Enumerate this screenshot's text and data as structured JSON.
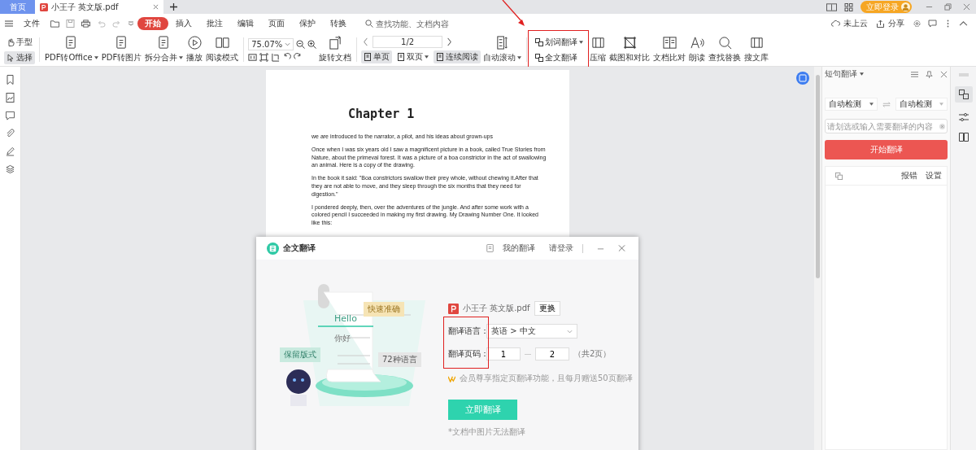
{
  "tabs": [
    {
      "label": "首页",
      "kind": "home",
      "selected": false
    },
    {
      "label": "小王子 英文版.pdf",
      "kind": "doc",
      "selected": true
    }
  ],
  "account": {
    "login": "立即登录"
  },
  "menu": {
    "items": [
      {
        "label": "文件",
        "selected": false
      },
      {
        "label": "开始",
        "selected": true
      },
      {
        "label": "插入",
        "selected": false
      },
      {
        "label": "批注",
        "selected": false
      },
      {
        "label": "编辑",
        "selected": false
      },
      {
        "label": "页面",
        "selected": false
      },
      {
        "label": "保护",
        "selected": false
      },
      {
        "label": "转换",
        "selected": false
      }
    ],
    "search_placeholder": "查找功能、文档内容",
    "cloud": "未上云",
    "share": "分享"
  },
  "toolbar": {
    "pointer_tools": [
      {
        "label": "手型",
        "selected": false
      },
      {
        "label": "选择",
        "selected": true
      }
    ],
    "convert_tools": [
      {
        "label": "PDF转Office",
        "dropdown": true
      },
      {
        "label": "PDF转图片",
        "dropdown": false
      },
      {
        "label": "拆分合并",
        "dropdown": true
      },
      {
        "label": "播放",
        "dropdown": false
      },
      {
        "label": "阅读模式",
        "dropdown": false
      }
    ],
    "zoom": "75.07%",
    "rotate": "旋转文档",
    "page": "1/2",
    "view_modes": [
      {
        "label": "单页",
        "selected": true,
        "dropdown": false
      },
      {
        "label": "双页",
        "selected": false,
        "dropdown": true
      },
      {
        "label": "连续阅读",
        "selected": true,
        "dropdown": false
      }
    ],
    "auto_scroll": "自动滚动",
    "translate": [
      {
        "label": "划词翻译",
        "dropdown": true
      },
      {
        "label": "全文翻译",
        "dropdown": false
      }
    ],
    "tools": [
      "压缩",
      "截图和对比",
      "文档比对",
      "朗读",
      "查找替换",
      "搜文库"
    ]
  },
  "document": {
    "title": "Chapter 1",
    "paragraphs": [
      "we are introduced to the narrator, a pilot, and his ideas about grown-ups",
      "Once when I was six years old I saw a magnificent picture in a book, called True Stories from Nature, about the primeval forest. It was a picture of a boa constrictor in the act of swallowing an animal. Here is a copy of the drawing.",
      "In the book it said: \"Boa constrictors swallow their prey whole, without chewing it.After that they are not able to move, and they sleep through the six months that they need for digestion.\"",
      "I pondered deeply, then, over the adventures of the jungle. And after some work with a colored pencil I succeeded in making my first drawing. My Drawing Number One. It looked like this:"
    ]
  },
  "side_panel": {
    "title": "短句翻译",
    "source_lang": "自动检测",
    "target_lang": "自动检测",
    "input_placeholder": "请划选或输入需要翻译的内容",
    "button": "开始翻译",
    "links": [
      "报错",
      "设置"
    ]
  },
  "dialog": {
    "title": "全文翻译",
    "my_translations": "我的翻译",
    "login": "请登录",
    "illustration_labels": [
      "快速准确",
      "Hello",
      "保留版式",
      "你好",
      "72种语言"
    ],
    "file_name": "小王子 英文版.pdf",
    "change_button": "更换",
    "language_label": "翻译语言：",
    "language": "英语 > 中文",
    "pages_label": "翻译页码：",
    "page_from": "1",
    "page_to": "2",
    "page_total": "（共2页）",
    "member_note": "会员尊享指定页翻译功能，且每月赠送50页翻译",
    "button": "立即翻译",
    "footnote": "*文档中图片无法翻译"
  }
}
